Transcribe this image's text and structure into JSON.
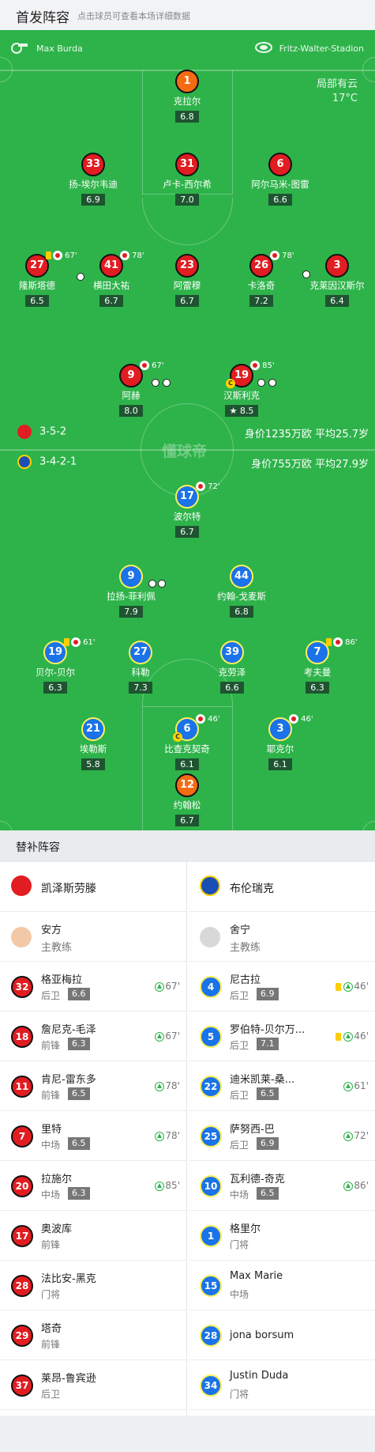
{
  "header": {
    "title": "首发阵容",
    "subtitle": "点击球员可查看本场详细数据"
  },
  "pitch": {
    "referee": "Max Burda",
    "stadium": "Fritz-Walter-Stadion",
    "weather": "局部有云",
    "temperature": "17°C",
    "logo_text": "懂球帝",
    "home_formation": "3-5-2",
    "home_value": "身价1235万欧 平均25.7岁",
    "away_formation": "3-4-2-1",
    "away_value": "身价755万欧 平均27.9岁"
  },
  "home_players": [
    {
      "num": "1",
      "name": "克拉尔",
      "rating": "6.8",
      "kind": "gk",
      "events": ""
    },
    {
      "num": "33",
      "name": "扬-埃尔韦迪",
      "rating": "6.9",
      "kind": "red",
      "events": ""
    },
    {
      "num": "31",
      "name": "卢卡-西尔希",
      "rating": "7.0",
      "kind": "red",
      "events": ""
    },
    {
      "num": "6",
      "name": "阿尔马米-图雷",
      "rating": "6.6",
      "kind": "red",
      "events": ""
    },
    {
      "num": "27",
      "name": "隆斯塔德",
      "rating": "6.5",
      "kind": "red",
      "events": "67'"
    },
    {
      "num": "41",
      "name": "横田大祐",
      "rating": "6.7",
      "kind": "red",
      "events": "78'"
    },
    {
      "num": "23",
      "name": "阿雷穆",
      "rating": "6.7",
      "kind": "red",
      "events": ""
    },
    {
      "num": "26",
      "name": "卡洛奇",
      "rating": "7.2",
      "kind": "red",
      "events": "78'"
    },
    {
      "num": "3",
      "name": "克莱因汉斯尔",
      "rating": "6.4",
      "kind": "red",
      "events": ""
    },
    {
      "num": "9",
      "name": "阿赫",
      "rating": "8.0",
      "kind": "red",
      "events": "67'"
    },
    {
      "num": "19",
      "name": "汉斯利克",
      "rating": "8.5",
      "kind": "red",
      "events": "85'"
    }
  ],
  "away_players": [
    {
      "num": "17",
      "name": "波尔特",
      "rating": "6.7",
      "events": "72'"
    },
    {
      "num": "9",
      "name": "拉扬-菲利佩",
      "rating": "7.9",
      "events": ""
    },
    {
      "num": "44",
      "name": "约翰-戈麦斯",
      "rating": "6.8",
      "events": ""
    },
    {
      "num": "19",
      "name": "贝尔-贝尔",
      "rating": "6.3",
      "events": "61'"
    },
    {
      "num": "27",
      "name": "科勒",
      "rating": "7.3",
      "events": ""
    },
    {
      "num": "39",
      "name": "克劳泽",
      "rating": "6.6",
      "events": ""
    },
    {
      "num": "7",
      "name": "考夫曼",
      "rating": "6.3",
      "events": "86'"
    },
    {
      "num": "21",
      "name": "埃勒斯",
      "rating": "5.8",
      "events": ""
    },
    {
      "num": "6",
      "name": "比查克契奇",
      "rating": "6.1",
      "events": "46'"
    },
    {
      "num": "3",
      "name": "耶克尔",
      "rating": "6.1",
      "events": "46'"
    },
    {
      "num": "12",
      "name": "约翰松",
      "rating": "6.7",
      "events": ""
    }
  ],
  "subs_header": "替补阵容",
  "home_team": {
    "name": "凯泽斯劳滕",
    "coach": "安方",
    "coach_role": "主教练"
  },
  "away_team": {
    "name": "布伦瑞克",
    "coach": "舍宁",
    "coach_role": "主教练"
  },
  "home_subs": [
    {
      "num": "32",
      "name": "格亚梅拉",
      "pos": "后卫",
      "rating": "6.6",
      "min": "67'"
    },
    {
      "num": "18",
      "name": "詹尼克-毛泽",
      "pos": "前锋",
      "rating": "6.3",
      "min": "67'"
    },
    {
      "num": "11",
      "name": "肯尼-雷东多",
      "pos": "前锋",
      "rating": "6.5",
      "min": "78'"
    },
    {
      "num": "7",
      "name": "里特",
      "pos": "中场",
      "rating": "6.5",
      "min": "78'"
    },
    {
      "num": "20",
      "name": "拉施尔",
      "pos": "中场",
      "rating": "6.3",
      "min": "85'"
    },
    {
      "num": "17",
      "name": "奥波库",
      "pos": "前锋",
      "rating": "",
      "min": ""
    },
    {
      "num": "28",
      "name": "法比安-黑克",
      "pos": "门将",
      "rating": "",
      "min": ""
    },
    {
      "num": "29",
      "name": "塔奇",
      "pos": "前锋",
      "rating": "",
      "min": ""
    },
    {
      "num": "37",
      "name": "莱昂-鲁宾逊",
      "pos": "后卫",
      "rating": "",
      "min": ""
    }
  ],
  "away_subs": [
    {
      "num": "4",
      "name": "尼古拉",
      "pos": "后卫",
      "rating": "6.9",
      "min": "46'"
    },
    {
      "num": "5",
      "name": "罗伯特-贝尔万...",
      "pos": "后卫",
      "rating": "7.1",
      "min": "46'"
    },
    {
      "num": "22",
      "name": "迪米凯莱-桑...",
      "pos": "后卫",
      "rating": "6.5",
      "min": "61'"
    },
    {
      "num": "25",
      "name": "萨努西-巴",
      "pos": "后卫",
      "rating": "6.9",
      "min": "72'"
    },
    {
      "num": "10",
      "name": "瓦利德-奇克",
      "pos": "中场",
      "rating": "6.5",
      "min": "86'"
    },
    {
      "num": "1",
      "name": "格里尔",
      "pos": "门将",
      "rating": "",
      "min": ""
    },
    {
      "num": "15",
      "name": "Max Marie",
      "pos": "中场",
      "rating": "",
      "min": ""
    },
    {
      "num": "28",
      "name": "jona borsum",
      "pos": "",
      "rating": "",
      "min": ""
    },
    {
      "num": "34",
      "name": "Justin Duda",
      "pos": "门将",
      "rating": "",
      "min": ""
    }
  ],
  "colors": {
    "pitch": "#2eb34a",
    "home": "#e11d21",
    "away": "#1a73e8",
    "gk": "#f56b12"
  }
}
